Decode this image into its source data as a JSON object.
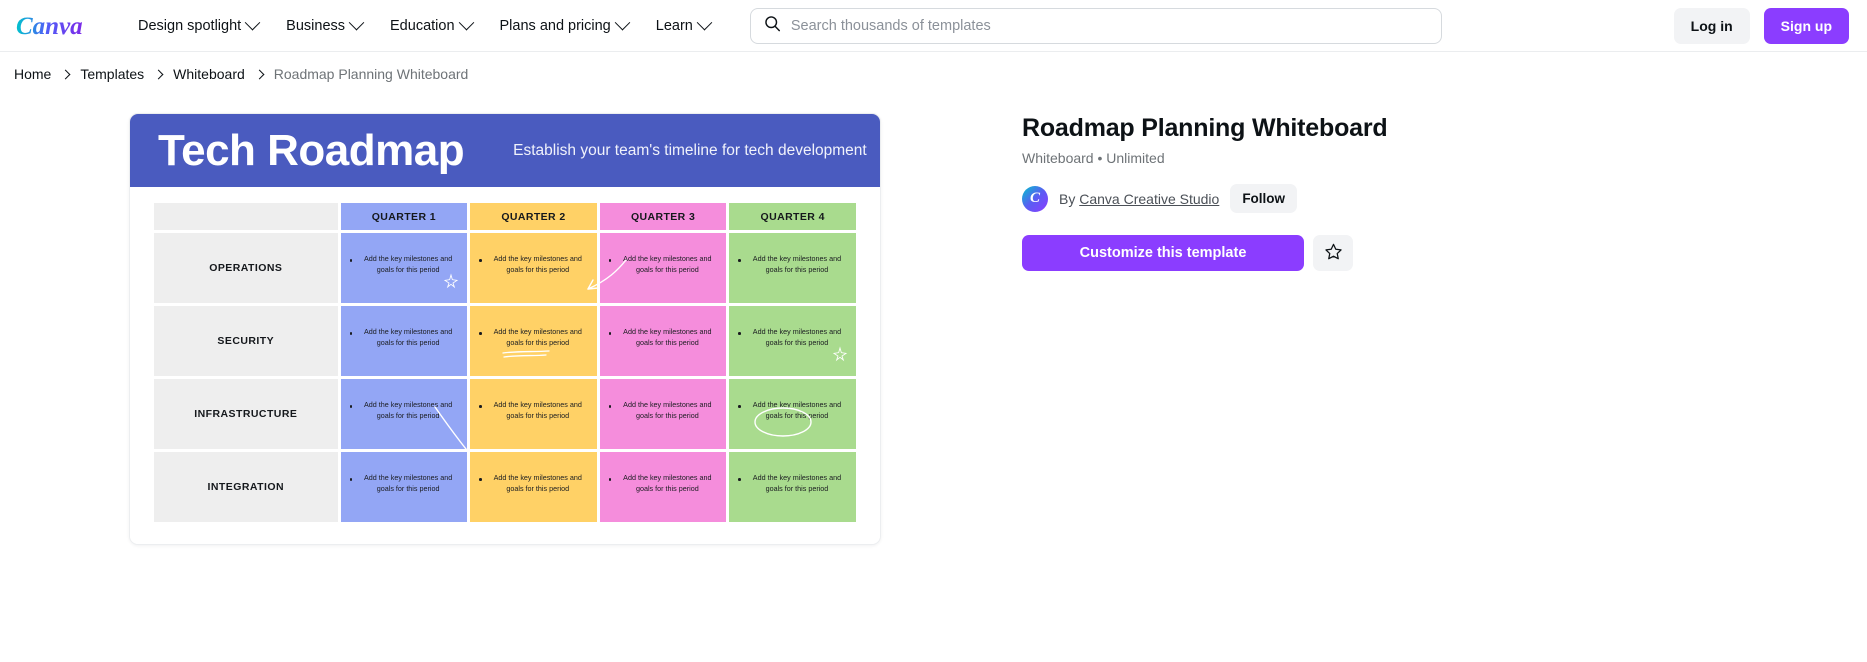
{
  "header": {
    "logo_text": "Canva",
    "nav": [
      {
        "label": "Design spotlight",
        "icon": "chevron-down-icon"
      },
      {
        "label": "Business",
        "icon": "chevron-down-icon"
      },
      {
        "label": "Education",
        "icon": "chevron-down-icon"
      },
      {
        "label": "Plans and pricing",
        "icon": "chevron-down-icon"
      },
      {
        "label": "Learn",
        "icon": "chevron-down-icon"
      }
    ],
    "search": {
      "icon": "search-icon",
      "placeholder": "Search thousands of templates",
      "value": ""
    },
    "login_label": "Log in",
    "signup_label": "Sign up",
    "accent_purple": "#8b3dff"
  },
  "breadcrumb": {
    "items": [
      "Home",
      "Templates",
      "Whiteboard",
      "Roadmap Planning Whiteboard"
    ]
  },
  "preview": {
    "design": {
      "title": "Tech Roadmap",
      "subtitle": "Establish your team's timeline for tech development",
      "header_color": "#4a5bbf",
      "columns": [
        "QUARTER 1",
        "QUARTER 2",
        "QUARTER 3",
        "QUARTER 4"
      ],
      "column_colors": [
        "#93a6f5",
        "#ffd166",
        "#f58ddc",
        "#a9db8e"
      ],
      "rows": [
        "OPERATIONS",
        "SECURITY",
        "INFRASTRUCTURE",
        "INTEGRATION"
      ],
      "cell_text": "Add the key milestones and goals for this period"
    }
  },
  "info": {
    "title": "Roadmap Planning Whiteboard",
    "meta": "Whiteboard • Unlimited",
    "by_prefix": "By",
    "author": "Canva Creative Studio",
    "avatar_letter": "C",
    "follow_label": "Follow",
    "cta_label": "Customize this template",
    "star_icon": "star-outline-icon"
  }
}
